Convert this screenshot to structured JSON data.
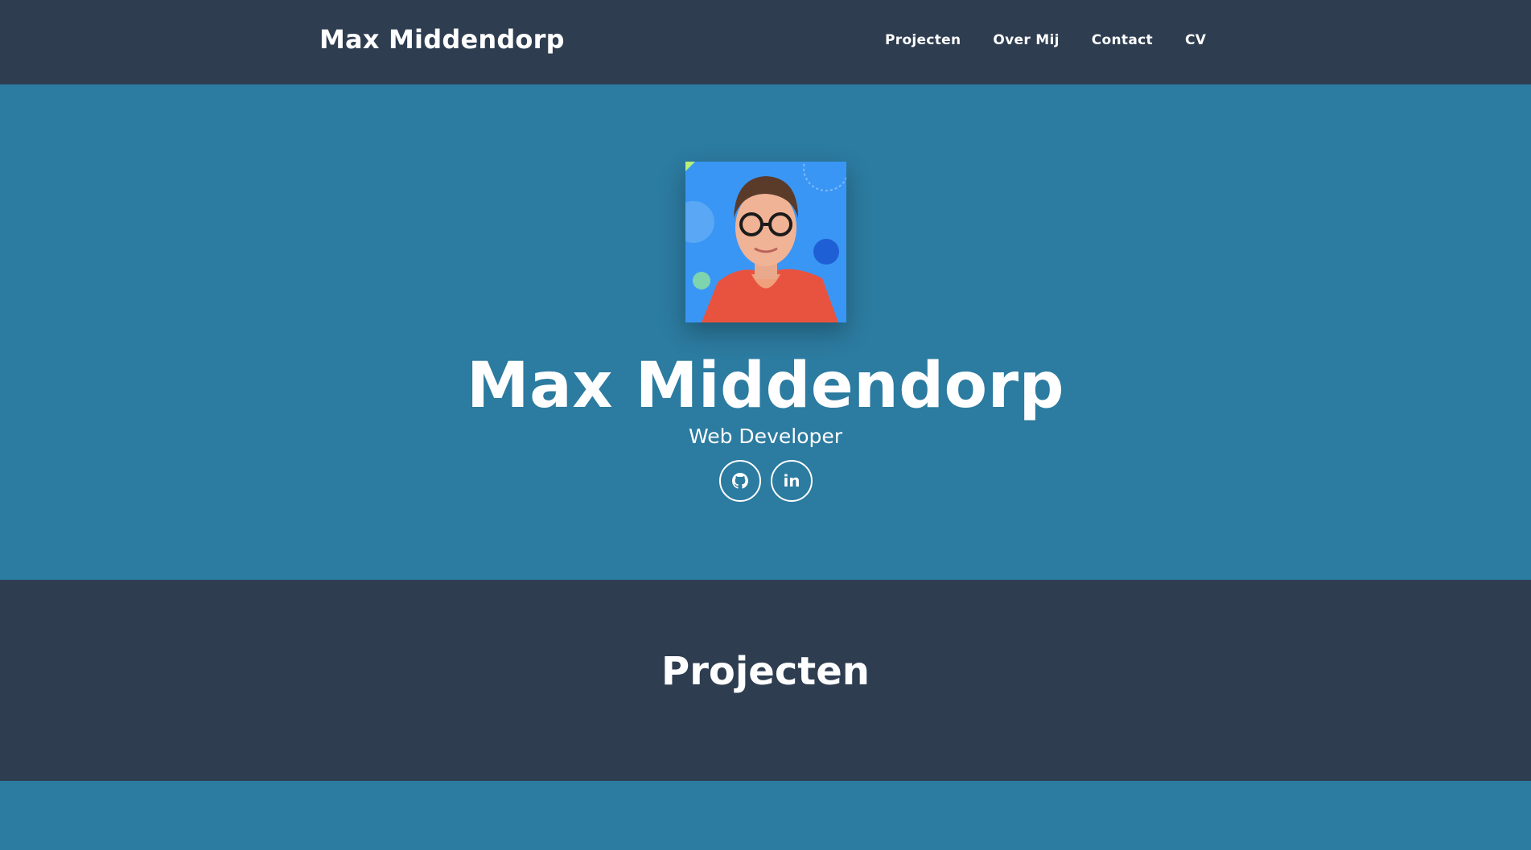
{
  "navbar": {
    "brand": "Max Middendorp",
    "links": [
      "Projecten",
      "Over Mij",
      "Contact",
      "CV"
    ]
  },
  "hero": {
    "avatar_alt": "profile-photo",
    "name": "Max Middendorp",
    "subtitle": "Web Developer",
    "socials": [
      {
        "name": "github-icon"
      },
      {
        "name": "linkedin-icon",
        "label": "in"
      }
    ]
  },
  "projects": {
    "title": "Projecten"
  },
  "colors": {
    "navbar_bg": "#2e3d50",
    "hero_bg": "#2c7ba0",
    "section_bg": "#2e3d50",
    "text": "#ffffff"
  }
}
